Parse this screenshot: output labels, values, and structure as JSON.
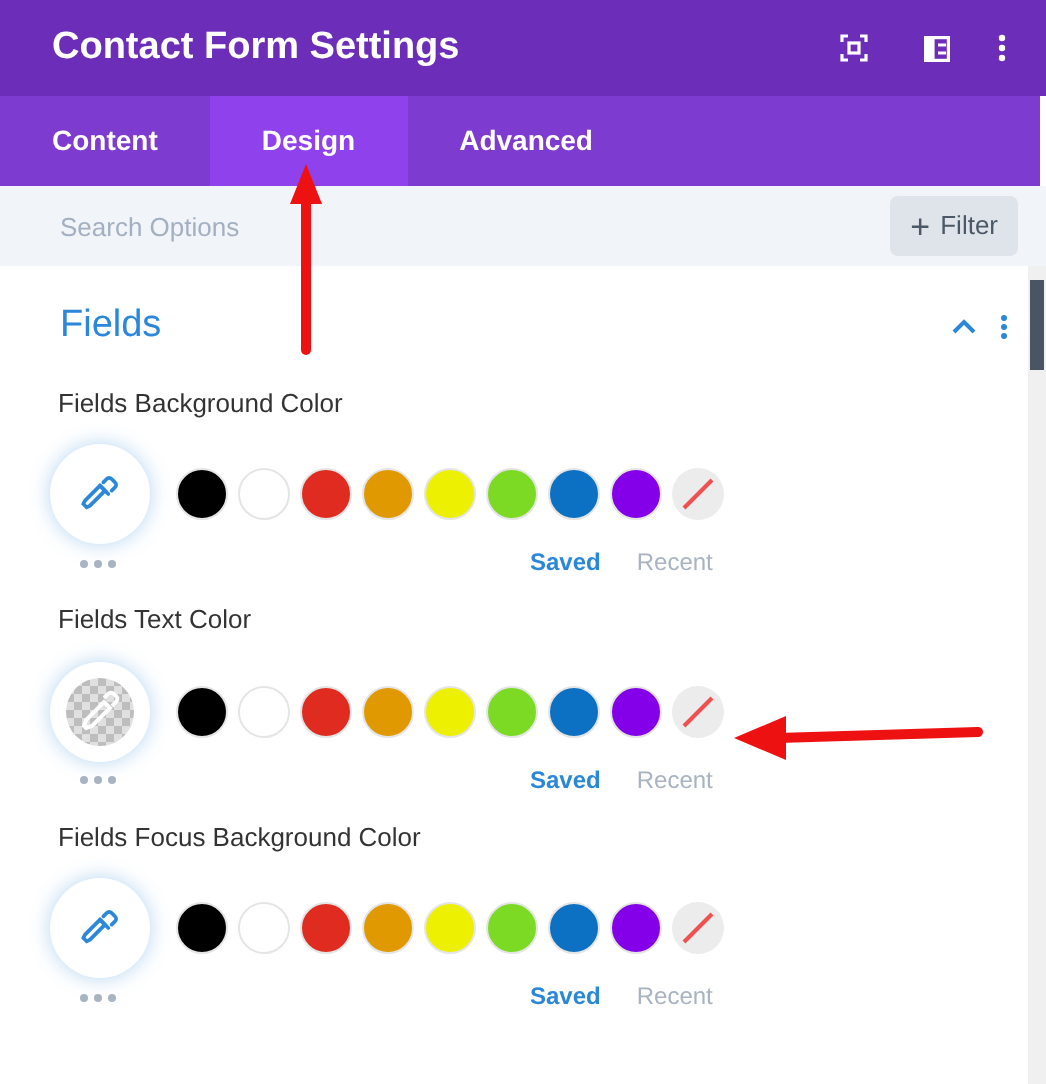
{
  "window": {
    "title": "Contact Form Settings"
  },
  "tabs": [
    {
      "label": "Content",
      "selected": false
    },
    {
      "label": "Design",
      "selected": true
    },
    {
      "label": "Advanced",
      "selected": false
    }
  ],
  "search": {
    "placeholder": "Search Options"
  },
  "filter_button": {
    "label": "Filter",
    "icon": "+"
  },
  "section": {
    "title": "Fields",
    "expanded": true
  },
  "fields": [
    {
      "label": "Fields Background Color",
      "kind": "eyedropper",
      "swatches": [
        {
          "kind": "color",
          "color": "#000000"
        },
        {
          "kind": "color",
          "color": "#ffffff"
        },
        {
          "kind": "color",
          "color": "#e02b20"
        },
        {
          "kind": "color",
          "color": "#e09900"
        },
        {
          "kind": "color",
          "color": "#edf000"
        },
        {
          "kind": "color",
          "color": "#7cda24"
        },
        {
          "kind": "color",
          "color": "#0c71c3"
        },
        {
          "kind": "color",
          "color": "#8300e9"
        },
        {
          "kind": "none"
        }
      ],
      "lists": [
        {
          "label": "Saved",
          "selected": true
        },
        {
          "label": "Recent",
          "selected": false
        }
      ]
    },
    {
      "label": "Fields Text Color",
      "kind": "transparent",
      "swatches": [
        {
          "kind": "color",
          "color": "#000000"
        },
        {
          "kind": "color",
          "color": "#ffffff"
        },
        {
          "kind": "color",
          "color": "#e02b20"
        },
        {
          "kind": "color",
          "color": "#e09900"
        },
        {
          "kind": "color",
          "color": "#edf000"
        },
        {
          "kind": "color",
          "color": "#7cda24"
        },
        {
          "kind": "color",
          "color": "#0c71c3"
        },
        {
          "kind": "color",
          "color": "#8300e9"
        },
        {
          "kind": "none"
        }
      ],
      "lists": [
        {
          "label": "Saved",
          "selected": true
        },
        {
          "label": "Recent",
          "selected": false
        }
      ]
    },
    {
      "label": "Fields Focus Background Color",
      "kind": "eyedropper",
      "swatches": [
        {
          "kind": "color",
          "color": "#000000"
        },
        {
          "kind": "color",
          "color": "#ffffff"
        },
        {
          "kind": "color",
          "color": "#e02b20"
        },
        {
          "kind": "color",
          "color": "#e09900"
        },
        {
          "kind": "color",
          "color": "#edf000"
        },
        {
          "kind": "color",
          "color": "#7cda24"
        },
        {
          "kind": "color",
          "color": "#0c71c3"
        },
        {
          "kind": "color",
          "color": "#8300e9"
        },
        {
          "kind": "none"
        }
      ],
      "lists": [
        {
          "label": "Saved",
          "selected": true
        },
        {
          "label": "Recent",
          "selected": false
        }
      ]
    }
  ]
}
